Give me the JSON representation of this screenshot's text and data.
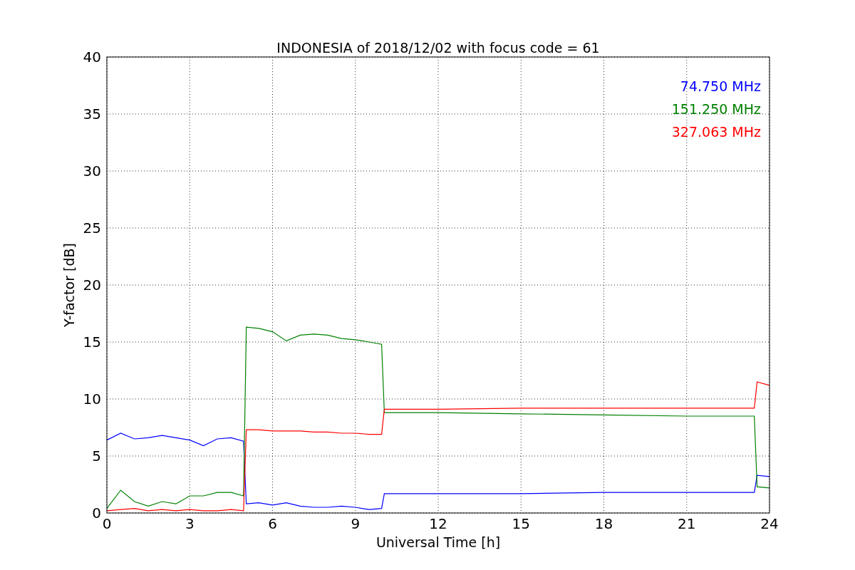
{
  "chart_data": {
    "type": "line",
    "title": "INDONESIA of 2018/12/02 with focus code = 61",
    "xlabel": "Universal Time [h]",
    "ylabel": "Y-factor [dB]",
    "x": [
      0,
      0.5,
      1,
      1.5,
      2,
      2.5,
      3,
      3.5,
      4,
      4.5,
      4.95,
      5.05,
      5.5,
      6,
      6.5,
      7,
      7.5,
      8,
      8.5,
      9,
      9.5,
      9.95,
      10.05,
      12,
      15,
      18,
      21,
      23.45,
      23.55,
      24
    ],
    "series": [
      {
        "name": "74.750 MHz",
        "color": "#0000ff",
        "values": [
          6.4,
          7.0,
          6.5,
          6.6,
          6.8,
          6.6,
          6.4,
          5.9,
          6.5,
          6.6,
          6.3,
          0.8,
          0.9,
          0.7,
          0.9,
          0.6,
          0.5,
          0.5,
          0.6,
          0.5,
          0.3,
          0.4,
          1.7,
          1.7,
          1.7,
          1.8,
          1.8,
          1.8,
          3.3,
          3.2
        ]
      },
      {
        "name": "151.250 MHz",
        "color": "#008000",
        "values": [
          0.4,
          2.0,
          1.0,
          0.6,
          1.0,
          0.8,
          1.5,
          1.5,
          1.8,
          1.8,
          1.5,
          16.3,
          16.2,
          15.9,
          15.1,
          15.6,
          15.7,
          15.6,
          15.3,
          15.2,
          15.0,
          14.8,
          8.8,
          8.8,
          8.7,
          8.6,
          8.5,
          8.5,
          2.3,
          2.2
        ]
      },
      {
        "name": "327.063 MHz",
        "color": "#ff0000",
        "values": [
          0.2,
          0.3,
          0.4,
          0.2,
          0.3,
          0.2,
          0.3,
          0.2,
          0.2,
          0.3,
          0.2,
          7.3,
          7.3,
          7.2,
          7.2,
          7.2,
          7.1,
          7.1,
          7.0,
          7.0,
          6.9,
          6.9,
          9.1,
          9.1,
          9.2,
          9.2,
          9.2,
          9.2,
          11.5,
          11.2
        ]
      }
    ],
    "grid": true,
    "xlim": [
      0,
      24
    ],
    "ylim": [
      0,
      40
    ],
    "xticks": [
      0,
      3,
      6,
      9,
      12,
      15,
      18,
      21,
      24
    ],
    "yticks": [
      0,
      5,
      10,
      15,
      20,
      25,
      30,
      35,
      40
    ]
  }
}
